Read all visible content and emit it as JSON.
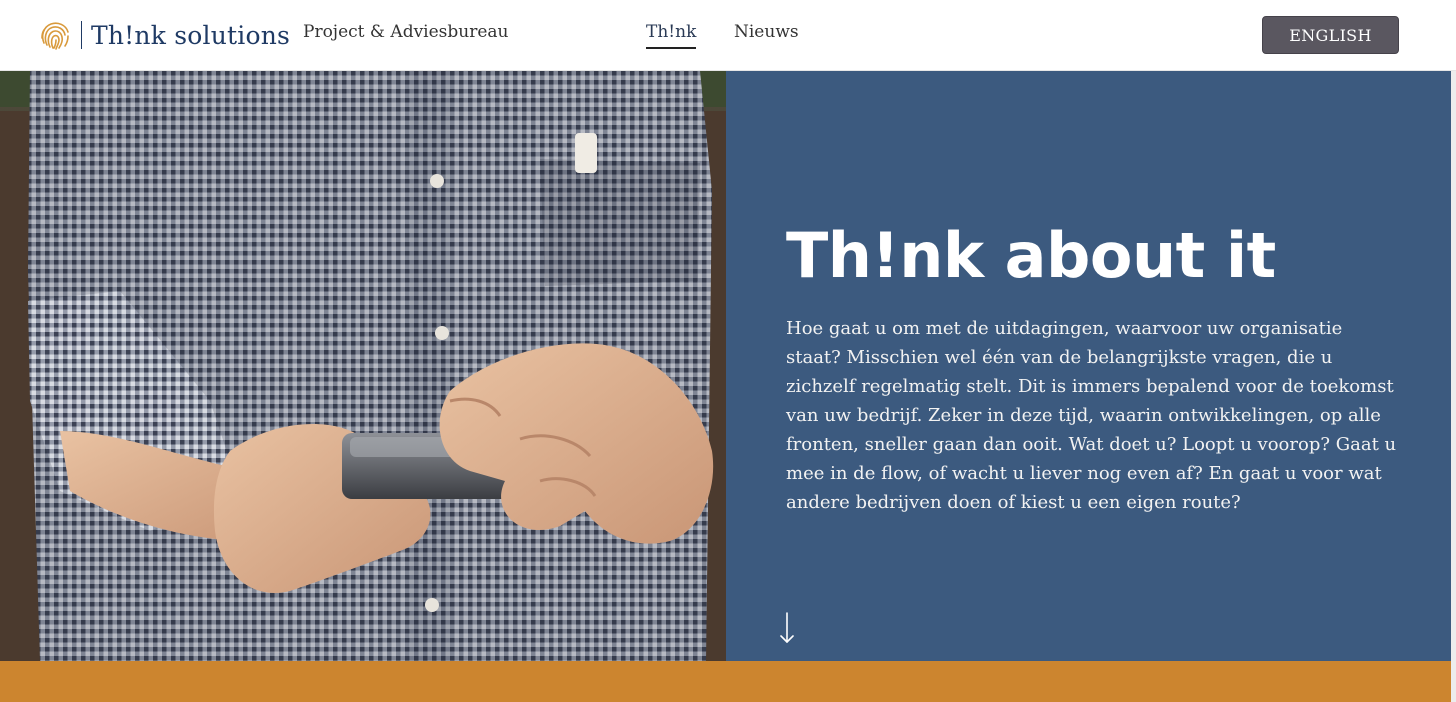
{
  "header": {
    "logo_text": "Th!nk solutions",
    "tagline": "Project & Adviesbureau",
    "nav": [
      {
        "label": "Th!nk",
        "active": true
      },
      {
        "label": "Nieuws",
        "active": false
      }
    ],
    "language_button": "ENGLISH"
  },
  "hero": {
    "title": "Th!nk about it",
    "body": "Hoe gaat u om met de uitdagingen, waarvoor uw organisatie staat? Misschien wel één van de belangrijkste vragen, die u zichzelf regelmatig stelt. Dit is immers bepalend voor de toekomst van uw bedrijf. Zeker in deze tijd, waarin ontwikkelingen, op alle fronten, sneller gaan dan ooit. Wat doet u? Loopt u voorop? Gaat u mee in de flow, of wacht u liever nog even af? En gaat u voor wat andere bedrijven doen of kiest u een eigen route?",
    "scroll_icon": "arrow-down-icon"
  },
  "colors": {
    "brand_navy": "#1f3a64",
    "logo_gold": "#d99a3c",
    "panel_blue": "#3c5a7f",
    "band_orange": "#cc852f",
    "button_gray": "#5a5760"
  }
}
